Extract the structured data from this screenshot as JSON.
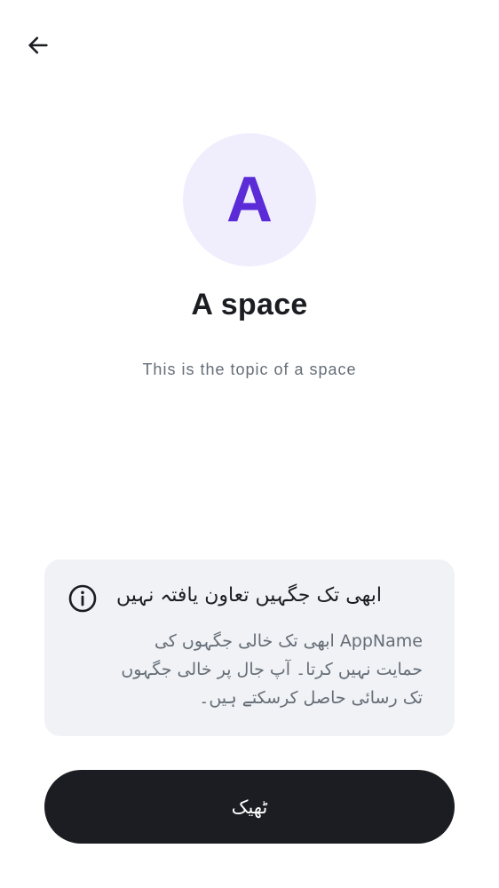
{
  "header": {
    "back_icon": "arrow-left-icon"
  },
  "space": {
    "avatar_letter": "A",
    "name": "A space",
    "topic": "This is the topic of a space",
    "avatar_bg": "#f0eefd",
    "avatar_fg": "#5a2bd6"
  },
  "notice": {
    "icon": "info-icon",
    "title": "ابھی تک جگہیں تعاون یافتہ نہیں",
    "body": "AppName ابھی تک خالی جگہوں کی حمایت نہیں کرتا۔ آپ جال پر خالی جگہوں تک رسائی حاصل کرسکتے ہیں۔"
  },
  "actions": {
    "ok_label": "ٹھیک"
  },
  "colors": {
    "primary_dark": "#1b1d22",
    "secondary_text": "#656d77",
    "card_bg": "#f0f2f5"
  }
}
